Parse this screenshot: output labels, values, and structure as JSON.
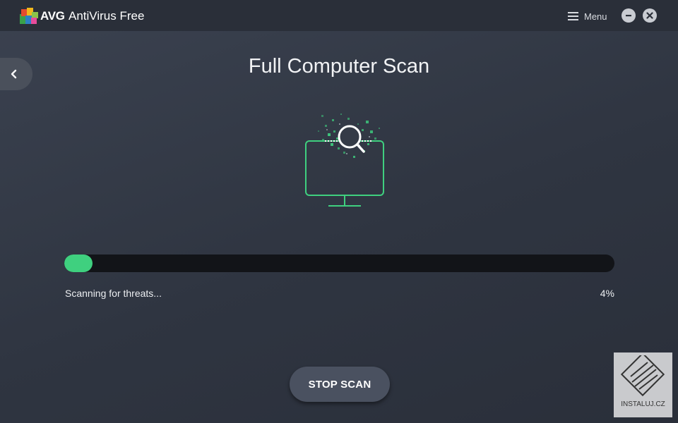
{
  "titlebar": {
    "brand": "AVG",
    "app_title": "AntiVirus Free",
    "menu_label": "Menu",
    "menu_icon": "hamburger-icon",
    "minimize_icon": "minus-icon",
    "close_icon": "close-icon"
  },
  "navigation": {
    "back_icon": "chevron-left-icon"
  },
  "main": {
    "page_title": "Full Computer Scan",
    "illustration_icon": "monitor-search-icon",
    "progress": {
      "status": "Scanning for threats...",
      "percent_label": "4%",
      "value": 0.04
    },
    "stop_button_label": "STOP SCAN"
  },
  "watermark": {
    "text": "INSTALUJ.CZ"
  },
  "colors": {
    "accent": "#3fd07f",
    "background": "#30363f",
    "titlebar": "#2a2f39",
    "progress_track": "#121418"
  }
}
